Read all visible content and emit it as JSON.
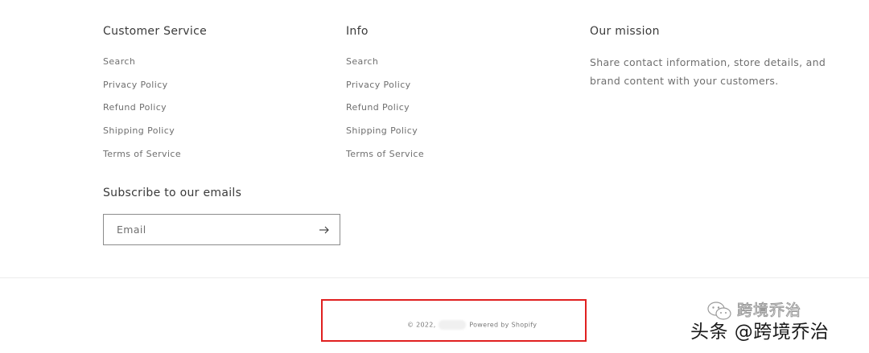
{
  "customer_service": {
    "heading": "Customer Service",
    "links": [
      "Search",
      "Privacy Policy",
      "Refund Policy",
      "Shipping Policy",
      "Terms of Service"
    ]
  },
  "info": {
    "heading": "Info",
    "links": [
      "Search",
      "Privacy Policy",
      "Refund Policy",
      "Shipping Policy",
      "Terms of Service"
    ]
  },
  "mission": {
    "heading": "Our mission",
    "text": "Share contact information, store details, and brand content with your customers."
  },
  "subscribe": {
    "heading": "Subscribe to our emails",
    "email_placeholder": "Email",
    "submit_icon": "arrow-right-icon"
  },
  "copyright": {
    "prefix": "© 2022,",
    "powered_by": "Powered by Shopify"
  },
  "watermark": {
    "account_name": "跨境乔治",
    "main_text": "头条 @跨境乔治"
  },
  "colors": {
    "highlight_border": "#e02020",
    "divider": "#ececec",
    "input_border": "#8c8c8c"
  }
}
